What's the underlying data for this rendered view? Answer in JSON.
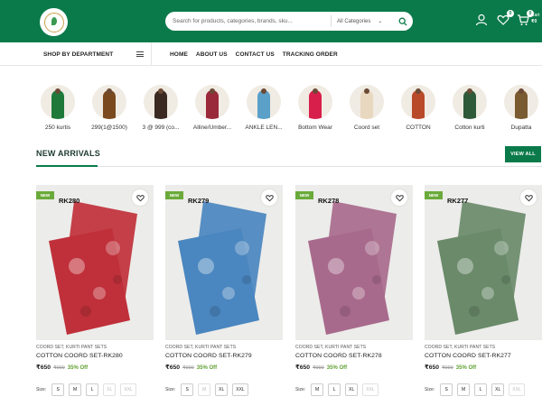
{
  "header": {
    "search_placeholder": "Search for products, categories, brands, sku...",
    "category_select": "All Categories",
    "wishlist_count": "0",
    "cart_count": "0",
    "cart_label": "Cart",
    "cart_total": "₹0",
    "colors": {
      "primary": "#0b7a4a"
    }
  },
  "nav": {
    "department_label": "SHOP BY DEPARTMENT",
    "links": [
      "HOME",
      "ABOUT US",
      "CONTACT US",
      "TRACKING ORDER"
    ]
  },
  "categories": [
    {
      "label": "250 kurtis",
      "color": "#1f7a3a"
    },
    {
      "label": "299(1@1500)",
      "color": "#7a4a1e"
    },
    {
      "label": "3 @ 999 (co...",
      "color": "#3a2a22"
    },
    {
      "label": "Alline/Umber...",
      "color": "#9a2a3a"
    },
    {
      "label": "ANKLE LEN...",
      "color": "#5aa0c8"
    },
    {
      "label": "Bottom Wear",
      "color": "#d81e4a"
    },
    {
      "label": "Coord set",
      "color": "#e8d8c0"
    },
    {
      "label": "COTTON",
      "color": "#b84a2a"
    },
    {
      "label": "Cotton kurti",
      "color": "#2f5a3a"
    },
    {
      "label": "Dupatta",
      "color": "#7a5a30"
    }
  ],
  "section": {
    "title": "NEW ARRIVALS",
    "view_all": "VIEW ALL"
  },
  "products": [
    {
      "badge": "NEW",
      "code": "RK280",
      "category": "COORD SET, KURTI PANT SETS",
      "name": "COTTON COORD SET-RK280",
      "price": "₹650",
      "mrp": "₹999",
      "discount": "35% Off",
      "color": "#c0303a",
      "sizes": [
        {
          "label": "S",
          "available": true
        },
        {
          "label": "M",
          "available": true
        },
        {
          "label": "L",
          "available": true
        },
        {
          "label": "XL",
          "available": false
        },
        {
          "label": "XXL",
          "available": false
        }
      ]
    },
    {
      "badge": "NEW",
      "code": "RK279",
      "category": "COORD SET, KURTI PANT SETS",
      "name": "COTTON COORD SET-RK279",
      "price": "₹650",
      "mrp": "₹999",
      "discount": "35% Off",
      "color": "#4a86bf",
      "sizes": [
        {
          "label": "S",
          "available": true
        },
        {
          "label": "M",
          "available": false
        },
        {
          "label": "XL",
          "available": true
        },
        {
          "label": "XXL",
          "available": true
        }
      ]
    },
    {
      "badge": "NEW",
      "code": "RK278",
      "category": "COORD SET, KURTI PANT SETS",
      "name": "COTTON COORD SET-RK278",
      "price": "₹650",
      "mrp": "₹999",
      "discount": "35% Off",
      "color": "#a86a8c",
      "sizes": [
        {
          "label": "M",
          "available": true
        },
        {
          "label": "L",
          "available": true
        },
        {
          "label": "XL",
          "available": true
        },
        {
          "label": "XXL",
          "available": false
        }
      ]
    },
    {
      "badge": "NEW",
      "code": "RK277",
      "category": "COORD SET, KURTI PANT SETS",
      "name": "COTTON COORD SET-RK277",
      "price": "₹650",
      "mrp": "₹999",
      "discount": "35% Off",
      "color": "#6a8a6a",
      "sizes": [
        {
          "label": "S",
          "available": true
        },
        {
          "label": "M",
          "available": true
        },
        {
          "label": "L",
          "available": true
        },
        {
          "label": "XL",
          "available": true
        },
        {
          "label": "XXL",
          "available": false
        }
      ]
    }
  ]
}
